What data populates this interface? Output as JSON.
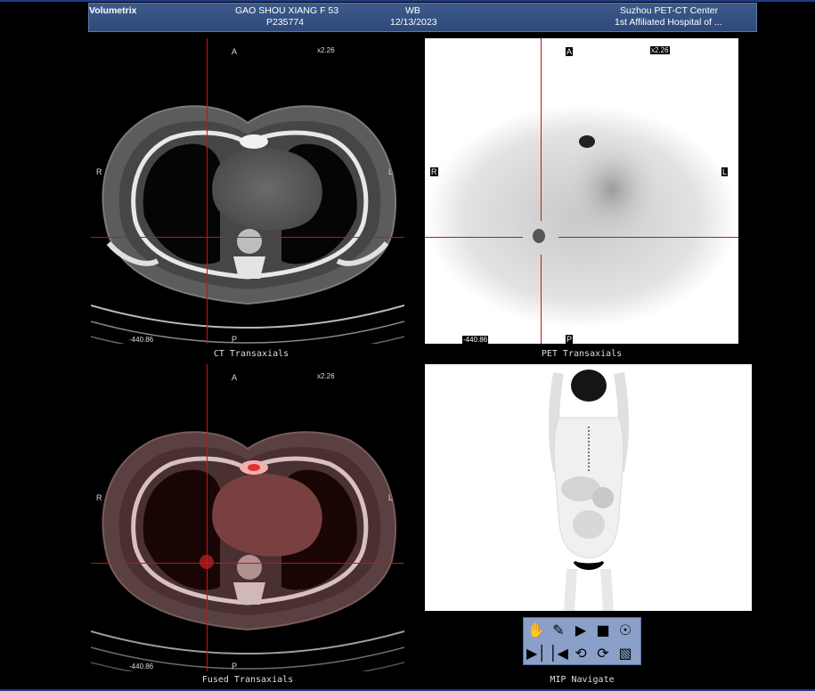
{
  "header": {
    "app_name": "Volumetrix",
    "patient_name": "GAO SHOU XIANG F 53",
    "patient_id": "P235774",
    "scan_type": "WB",
    "scan_date": "12/13/2023",
    "center": "Suzhou PET-CT Center",
    "hospital": "1st Affiliated Hospital of ..."
  },
  "viewports": {
    "ct": {
      "label": "CT Transaxials",
      "top": "A",
      "bottom": "P",
      "left": "R",
      "right": "L",
      "zoom": "x2.26",
      "level": "-440.86"
    },
    "pet": {
      "label": "PET Transaxials",
      "top": "A",
      "bottom": "P",
      "left": "R",
      "right": "L",
      "zoom": "x2.26",
      "level": "-440.86"
    },
    "fused": {
      "label": "Fused Transaxials",
      "top": "A",
      "bottom": "P",
      "left": "R",
      "right": "L",
      "zoom": "x2.26",
      "level": "-440.86"
    },
    "mip": {
      "label": "MIP Navigate"
    }
  },
  "controls": {
    "buttons": [
      "hand-icon",
      "brush-icon",
      "play-icon",
      "stop-icon",
      "target-icon",
      "step-next-icon",
      "step-prev-icon",
      "rotate-icon",
      "spiral-icon",
      "export-icon"
    ]
  },
  "colors": {
    "header_bg": "#2e4a7a",
    "crosshair": "#d01010",
    "control_bg": "#8aa0c8"
  }
}
